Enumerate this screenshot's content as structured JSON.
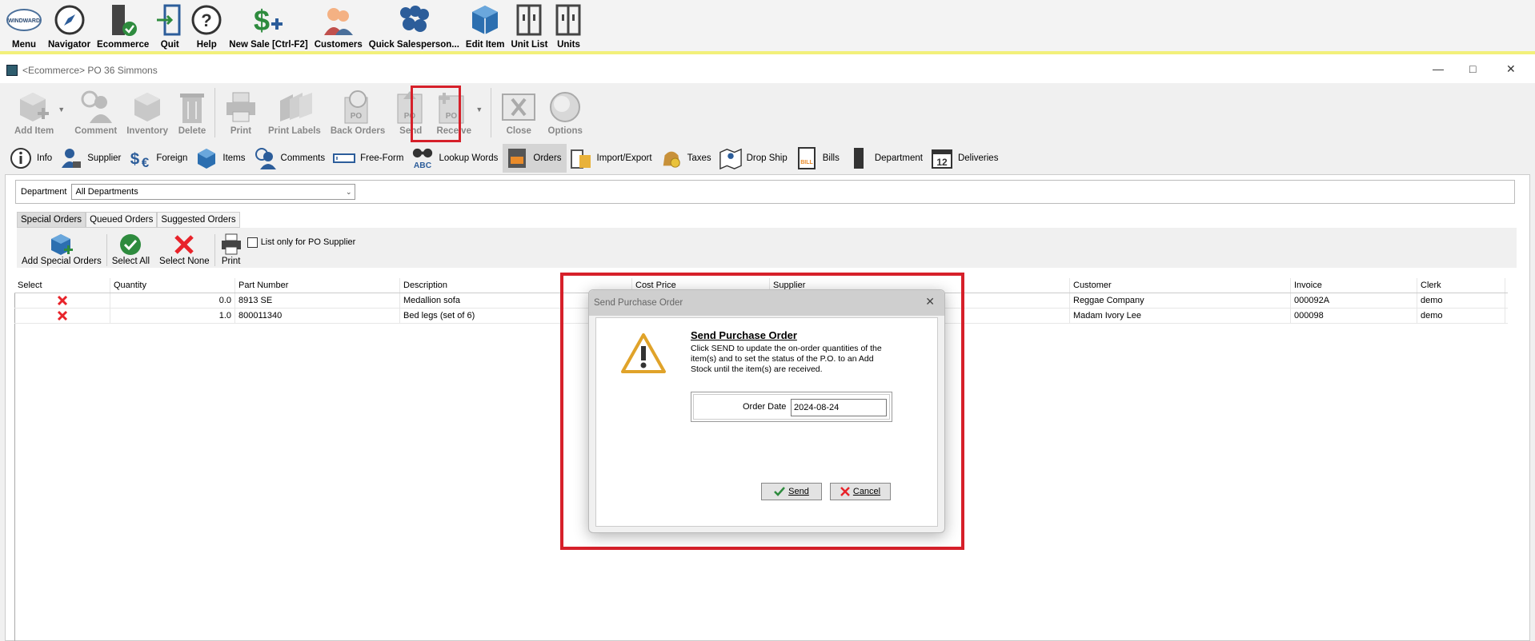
{
  "top_toolbar": {
    "items": [
      {
        "label": "Menu",
        "icon": "windward-logo-icon"
      },
      {
        "label": "Navigator",
        "icon": "compass-icon"
      },
      {
        "label": "Ecommerce",
        "icon": "ecommerce-icon"
      },
      {
        "label": "Quit",
        "icon": "exit-door-icon"
      },
      {
        "label": "Help",
        "icon": "help-icon"
      },
      {
        "label": "New Sale [Ctrl-F2]",
        "icon": "dollar-plus-icon"
      },
      {
        "label": "Customers",
        "icon": "customers-icon"
      },
      {
        "label": "Quick Salesperson...",
        "icon": "salespeople-icon"
      },
      {
        "label": "Edit Item",
        "icon": "box-icon"
      },
      {
        "label": "Unit List",
        "icon": "unit-list-icon"
      },
      {
        "label": "Units",
        "icon": "units-icon"
      }
    ],
    "logo_text": "WINDWARD"
  },
  "window": {
    "title": "<Ecommerce> PO 36 Simmons"
  },
  "ribbon": {
    "items": [
      {
        "label": "Add Item",
        "icon": "add-item-icon"
      },
      {
        "label": "Comment",
        "icon": "comment-icon"
      },
      {
        "label": "Inventory",
        "icon": "inventory-icon"
      },
      {
        "label": "Delete",
        "icon": "trash-icon"
      },
      {
        "label": "Print",
        "icon": "printer-icon"
      },
      {
        "label": "Print Labels",
        "icon": "labels-icon"
      },
      {
        "label": "Back Orders",
        "icon": "back-orders-icon"
      },
      {
        "label": "Send",
        "icon": "send-po-icon"
      },
      {
        "label": "Receive",
        "icon": "receive-po-icon"
      },
      {
        "label": "Close",
        "icon": "close-po-icon"
      },
      {
        "label": "Options",
        "icon": "options-icon"
      }
    ],
    "po_badge": "PO"
  },
  "tabs": [
    {
      "label": "Info",
      "icon": "info-icon"
    },
    {
      "label": "Supplier",
      "icon": "supplier-icon"
    },
    {
      "label": "Foreign",
      "icon": "currency-icon"
    },
    {
      "label": "Items",
      "icon": "items-cube-icon"
    },
    {
      "label": "Comments",
      "icon": "comments-icon"
    },
    {
      "label": "Free-Form",
      "icon": "free-form-icon"
    },
    {
      "label": "Lookup Words",
      "icon": "binoculars-icon"
    },
    {
      "label": "Orders",
      "icon": "orders-icon"
    },
    {
      "label": "Import/Export",
      "icon": "import-export-icon"
    },
    {
      "label": "Taxes",
      "icon": "taxes-icon"
    },
    {
      "label": "Drop Ship",
      "icon": "map-pin-icon"
    },
    {
      "label": "Bills",
      "icon": "bills-icon"
    },
    {
      "label": "Department",
      "icon": "department-icon"
    },
    {
      "label": "Deliveries",
      "icon": "calendar-icon"
    }
  ],
  "tab_icon_text": {
    "lookup": "ABC",
    "calendar": "12",
    "bills": "BILL"
  },
  "department": {
    "label": "Department",
    "value": "All Departments"
  },
  "subtabs": [
    "Special Orders",
    "Queued Orders",
    "Suggested Orders"
  ],
  "order_tools": {
    "add": "Add Special Orders",
    "select_all": "Select All",
    "select_none": "Select None",
    "print": "Print",
    "list_only": "List only for PO Supplier"
  },
  "grid": {
    "headers": [
      "Select",
      "Quantity",
      "Part Number",
      "Description",
      "Cost Price",
      "Supplier",
      "Customer",
      "Invoice",
      "Clerk"
    ],
    "rows": [
      {
        "quantity": "0.0",
        "part": "8913 SE",
        "description": "Medallion sofa",
        "customer": "Reggae Company",
        "invoice": "000092A",
        "clerk": "demo"
      },
      {
        "quantity": "1.0",
        "part": "800011340",
        "description": "Bed legs (set of 6)",
        "customer": "Madam Ivory Lee",
        "invoice": "000098",
        "clerk": "demo"
      }
    ]
  },
  "dialog": {
    "title": "Send Purchase Order",
    "heading": "Send Purchase Order",
    "message": "Click SEND to update the on-order quantities of the item(s) and to set the status of the P.O. to an Add Stock until the item(s) are received.",
    "order_date_label": "Order Date",
    "order_date_value": "2024-08-24",
    "send_label": "Send",
    "cancel_label": "Cancel"
  },
  "colors": {
    "highlight": "#d6202a",
    "accent_blue": "#1f5fa8",
    "accent_green": "#2e8b3e",
    "toolbar_stripe": "#f2f07a"
  }
}
